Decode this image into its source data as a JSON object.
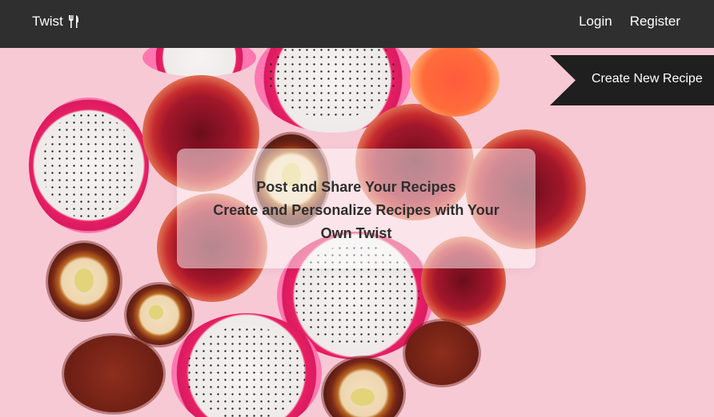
{
  "navbar": {
    "brand": "Twist",
    "brand_icon": "fork-knife-icon",
    "links": [
      "Login",
      "Register"
    ]
  },
  "cta": {
    "label": "Create New Recipe"
  },
  "hero": {
    "line1": "Post and Share Your Recipes",
    "line2": "Create and Personalize Recipes with Your",
    "line3": "Own Twist"
  },
  "colors": {
    "navbar": "#2f2f2f",
    "ribbon": "#1f1f1f",
    "background": "#f7c9d5"
  }
}
